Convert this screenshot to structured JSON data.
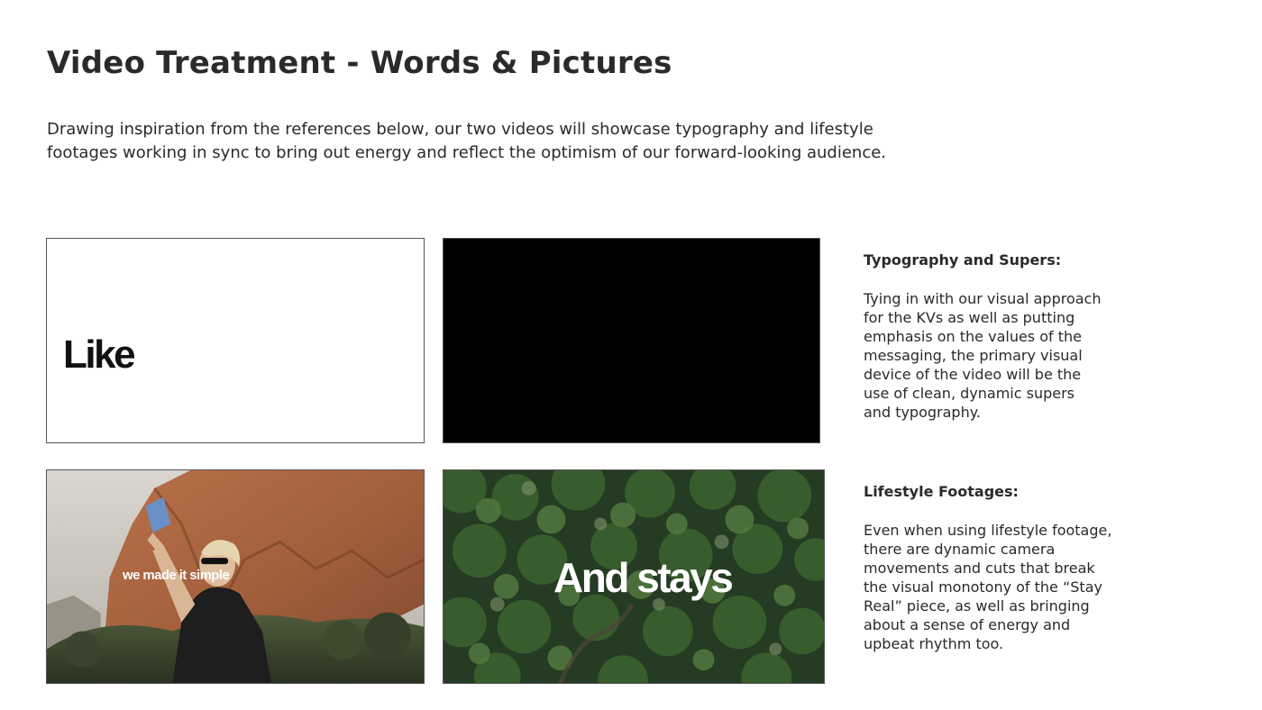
{
  "page": {
    "title": "Video Treatment - Words & Pictures",
    "intro": "Drawing inspiration from the references below, our two videos will showcase typography and lifestyle footages working in sync to bring out energy and reflect the optimism of our forward-looking audience."
  },
  "frames": [
    {
      "text": "Like",
      "background": "#ffffff"
    },
    {
      "text": "",
      "background": "#000000"
    },
    {
      "text": "we made it simple",
      "background": "photo-desert-cliff"
    },
    {
      "text": "And stays",
      "background": "photo-forest-aerial"
    }
  ],
  "sections": [
    {
      "heading": "Typography and Supers:",
      "body": "Tying in with our visual approach for the KVs as well as putting emphasis on the values of the messaging, the primary visual device of the video will be the use of clean, dynamic supers and typography."
    },
    {
      "heading": "Lifestyle Footages:",
      "body": "Even when using lifestyle footage, there are dynamic camera movements and cuts that break the visual monotony of the “Stay Real” piece, as well as bringing about a sense of energy and upbeat rhythm too."
    }
  ]
}
